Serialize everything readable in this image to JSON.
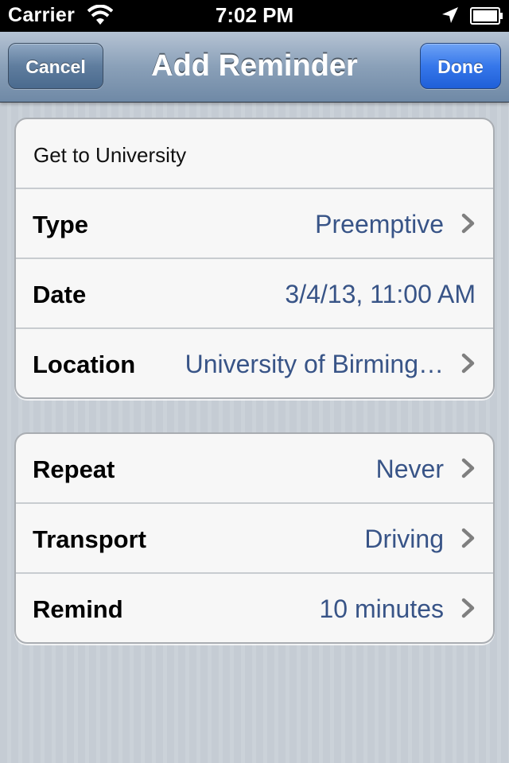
{
  "status_bar": {
    "carrier": "Carrier",
    "time": "7:02 PM",
    "icons": [
      "wifi-icon",
      "location-arrow-icon",
      "battery-icon"
    ]
  },
  "nav": {
    "title": "Add Reminder",
    "cancel_label": "Cancel",
    "done_label": "Done"
  },
  "colors": {
    "value_text": "#385487",
    "done_button": "#3677ea",
    "nav_bar": "#8aa0b8"
  },
  "group1": {
    "title_field": "Get to University",
    "type_label": "Type",
    "type_value": "Preemptive",
    "date_label": "Date",
    "date_value": "3/4/13, 11:00 AM",
    "location_label": "Location",
    "location_value": "University of Birming…"
  },
  "group2": {
    "repeat_label": "Repeat",
    "repeat_value": "Never",
    "transport_label": "Transport",
    "transport_value": "Driving",
    "remind_label": "Remind",
    "remind_value": "10 minutes"
  }
}
